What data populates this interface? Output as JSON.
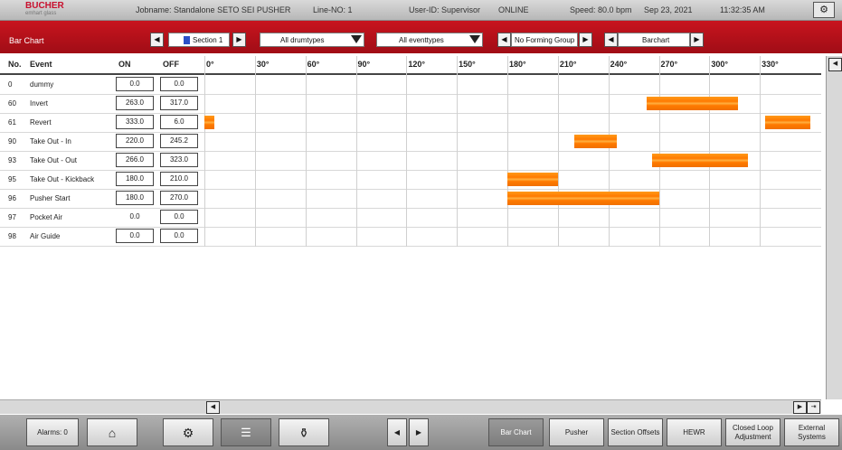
{
  "header": {
    "logo_name": "BUCHER",
    "logo_sub": "emhart glass",
    "jobname": "Jobname: Standalone SETO SEI PUSHER",
    "line_no": "Line-NO: 1",
    "user_id": "User-ID: Supervisor",
    "status": "ONLINE",
    "speed": "Speed: 80.0 bpm",
    "date": "Sep 23, 2021",
    "time": "11:32:35 AM"
  },
  "toolbar": {
    "title": "Bar Chart",
    "section": "Section 1",
    "drumtypes": "All drumtypes",
    "eventtypes": "All eventtypes",
    "forming_group": "No Forming Group",
    "view": "Barchart"
  },
  "table": {
    "headers": {
      "no": "No.",
      "event": "Event",
      "on": "ON",
      "off": "OFF"
    },
    "rows": [
      {
        "no": "0",
        "event": "dummy",
        "on": "0.0",
        "off": "0.0"
      },
      {
        "no": "60",
        "event": "Invert",
        "on": "263.0",
        "off": "317.0"
      },
      {
        "no": "61",
        "event": "Revert",
        "on": "333.0",
        "off": "6.0"
      },
      {
        "no": "90",
        "event": "Take Out - In",
        "on": "220.0",
        "off": "245.2"
      },
      {
        "no": "93",
        "event": "Take Out - Out",
        "on": "266.0",
        "off": "323.0"
      },
      {
        "no": "95",
        "event": "Take Out - Kickback",
        "on": "180.0",
        "off": "210.0"
      },
      {
        "no": "96",
        "event": "Pusher Start",
        "on": "180.0",
        "off": "270.0"
      },
      {
        "no": "97",
        "event": "Pocket Air",
        "on": "0.0",
        "off": "0.0"
      },
      {
        "no": "98",
        "event": "Air Guide",
        "on": "0.0",
        "off": "0.0"
      }
    ]
  },
  "chart_data": {
    "type": "bar",
    "degree_labels": [
      "0°",
      "30°",
      "60°",
      "90°",
      "120°",
      "150°",
      "180°",
      "210°",
      "240°",
      "270°",
      "300°",
      "330°"
    ],
    "xlim": [
      0,
      360
    ],
    "bars": [
      {
        "row": 1,
        "start": 263.0,
        "end": 317.0
      },
      {
        "row": 2,
        "start": 333.0,
        "end": 360.0
      },
      {
        "row": 2,
        "start": 0.0,
        "end": 6.0
      },
      {
        "row": 3,
        "start": 220.0,
        "end": 245.2
      },
      {
        "row": 4,
        "start": 266.0,
        "end": 323.0
      },
      {
        "row": 5,
        "start": 180.0,
        "end": 210.0
      },
      {
        "row": 6,
        "start": 180.0,
        "end": 270.0
      }
    ],
    "bar_color": "#ff7a00"
  },
  "footer": {
    "alarms": "Alarms: 0",
    "bar_chart": "Bar Chart",
    "pusher": "Pusher",
    "section_offsets": "Section Offsets",
    "hewr": "HEWR",
    "closed_loop": "Closed Loop Adjustment",
    "external": "External Systems"
  }
}
